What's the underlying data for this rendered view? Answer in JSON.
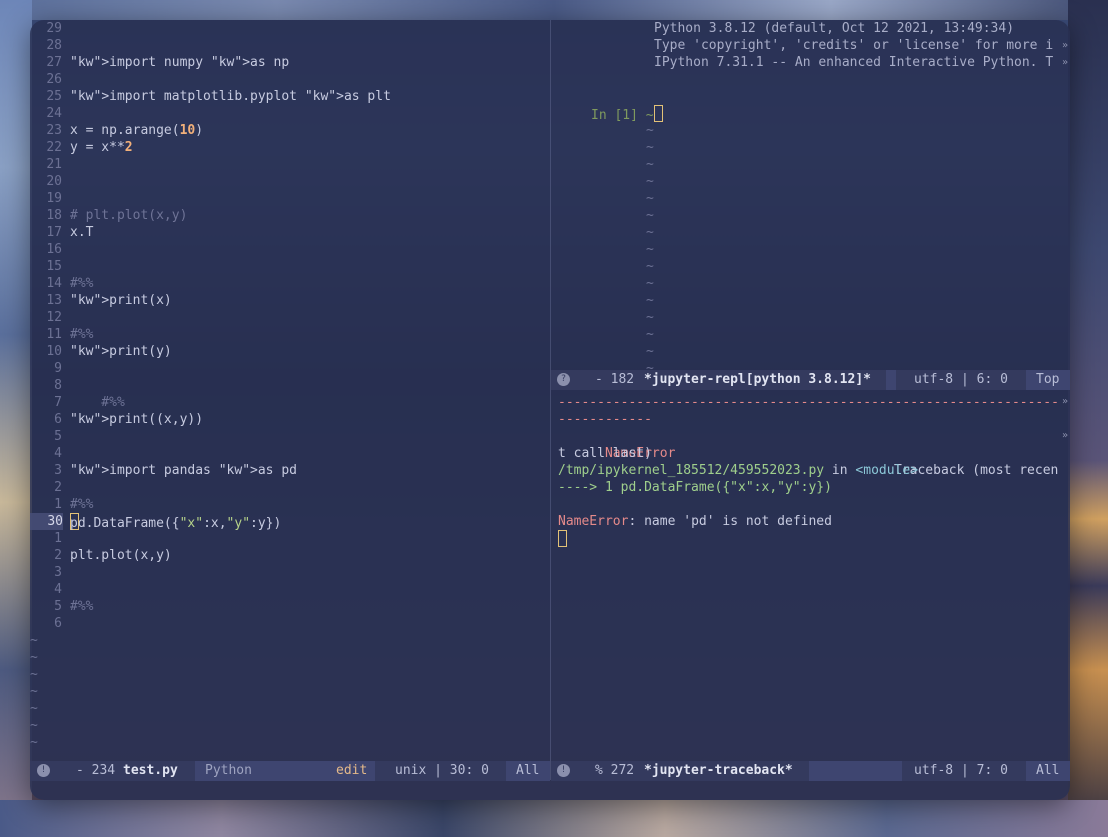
{
  "editor": {
    "lines": [
      {
        "n": "29",
        "code": ""
      },
      {
        "n": "28",
        "code": ""
      },
      {
        "n": "27",
        "code": "import numpy as np"
      },
      {
        "n": "26",
        "code": ""
      },
      {
        "n": "25",
        "code": "import matplotlib.pyplot as plt"
      },
      {
        "n": "24",
        "code": ""
      },
      {
        "n": "23",
        "code": "x = np.arange(10)"
      },
      {
        "n": "22",
        "code": "y = x**2"
      },
      {
        "n": "21",
        "code": ""
      },
      {
        "n": "20",
        "code": ""
      },
      {
        "n": "19",
        "code": ""
      },
      {
        "n": "18",
        "code": "# plt.plot(x,y)"
      },
      {
        "n": "17",
        "code": "x.T"
      },
      {
        "n": "16",
        "code": ""
      },
      {
        "n": "15",
        "code": ""
      },
      {
        "n": "14",
        "code": "#%%"
      },
      {
        "n": "13",
        "code": "print(x)"
      },
      {
        "n": "12",
        "code": ""
      },
      {
        "n": "11",
        "code": "#%%"
      },
      {
        "n": "10",
        "code": "print(y)"
      },
      {
        "n": "9",
        "code": ""
      },
      {
        "n": "8",
        "code": ""
      },
      {
        "n": "7",
        "code": "    #%%"
      },
      {
        "n": "6",
        "code": "print((x,y))"
      },
      {
        "n": "5",
        "code": ""
      },
      {
        "n": "4",
        "code": ""
      },
      {
        "n": "3",
        "code": "import pandas as pd"
      },
      {
        "n": "2",
        "code": ""
      },
      {
        "n": "1",
        "code": "#%%"
      },
      {
        "n": "30",
        "code": "pd.DataFrame({\"x\":x,\"y\":y})"
      },
      {
        "n": "1",
        "code": ""
      },
      {
        "n": "2",
        "code": "plt.plot(x,y)"
      },
      {
        "n": "3",
        "code": ""
      },
      {
        "n": "4",
        "code": ""
      },
      {
        "n": "5",
        "code": "#%%"
      },
      {
        "n": "6",
        "code": ""
      }
    ],
    "tilde": "~"
  },
  "repl": {
    "banner": [
      "Python 3.8.12 (default, Oct 12 2021, 13:49:34)",
      "Type 'copyright', 'credits' or 'license' for more i",
      "IPython 7.31.1 -- An enhanced Interactive Python. T"
    ],
    "prompt": "In [1] ~",
    "tilde": "~"
  },
  "traceback": {
    "dashes1": "----------------------------------------------------------------",
    "dashes2": "------------",
    "error_name": "NameError",
    "traceback_header": "Traceback (most recen",
    "wrap_cont": "t call last)",
    "file_path": "/tmp/ipykernel_185512/459552023.py",
    "in_word": " in ",
    "module": "<module>",
    "arrow_line": "----> 1 pd.DataFrame({\"x\":x,\"y\":y})",
    "error_msg": ": name 'pd' is not defined"
  },
  "modeline_left": {
    "badge": "!",
    "status": "- 234",
    "buffer": "test.py",
    "mode": "Python",
    "state": "edit",
    "encoding": "unix | 30: 0",
    "position": "All"
  },
  "modeline_right_top": {
    "badge": "?",
    "status": "- 182",
    "buffer": "*jupyter-repl[python 3.8.12]*",
    "encoding": "utf-8 | 6: 0",
    "position": "Top"
  },
  "modeline_right_bottom": {
    "badge": "!",
    "status": "% 272",
    "buffer": "*jupyter-traceback*",
    "encoding": "utf-8 | 7: 0",
    "position": "All"
  }
}
